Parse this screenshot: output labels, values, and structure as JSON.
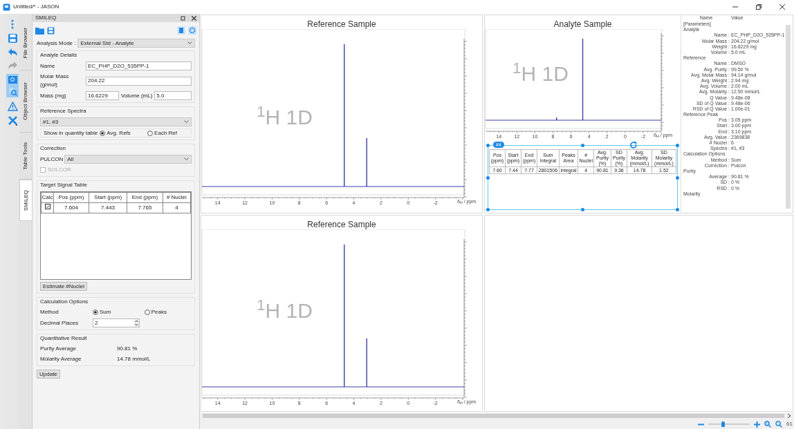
{
  "window": {
    "title": "Untitled/* - JASON"
  },
  "side_tabs": [
    {
      "label": "File Browser",
      "selected": false
    },
    {
      "label": "Object Browser",
      "selected": false
    },
    {
      "label": "Table Tools",
      "selected": false
    },
    {
      "label": "SMILEQ",
      "selected": true
    }
  ],
  "panel": {
    "title": "SMILEQ",
    "analysis_mode_label": "Analysis Mode :",
    "analysis_mode": "External Std - Analyte",
    "analyte_details": {
      "title": "Analyte Details",
      "fields": [
        {
          "label": "Name",
          "value": "EC_PHP_D2O_535PP-1"
        },
        {
          "label": "Molar Mass (g/mol)",
          "value": "204.22"
        }
      ],
      "mass_label": "Mass (mg)",
      "mass": "16.6229",
      "volume_label": "Volume (mL)",
      "volume": "5.0"
    },
    "reference_spectra": {
      "title": "Reference Spectra",
      "value": "#1, #3",
      "show_label": "Show in quantity table",
      "options": [
        {
          "label": "Avg. Refs",
          "selected": true
        },
        {
          "label": "Each Ref",
          "selected": false
        }
      ]
    },
    "correction": {
      "title": "Correction",
      "pulcon_label": "PULCON",
      "pulcon": "All",
      "solcor": {
        "label": "SOLCOR",
        "checked": false,
        "disabled": true
      }
    },
    "target_signal_table": {
      "title": "Target Signal Table",
      "calc_column": "Calc",
      "columns": [
        "Pos (ppm)",
        "Start (ppm)",
        "End (ppm)",
        "# Nuclei"
      ],
      "rows": [
        {
          "checked": true,
          "cells": [
            "7.604",
            "7.443",
            "7.765",
            "4"
          ]
        }
      ],
      "button": "Estimate #Nuclei"
    },
    "calculation_options": {
      "title": "Calculation Options",
      "method_label": "Method",
      "methods": [
        {
          "label": "Sum",
          "selected": true
        },
        {
          "label": "Peaks",
          "selected": false
        }
      ],
      "decimal_label": "Decimal Places",
      "decimal": "2"
    },
    "quantitative_result": {
      "title": "Quantitative Result",
      "rows": [
        {
          "label": "Purity Average",
          "value": "90.81 %"
        },
        {
          "label": "Molarity Average",
          "value": "14.78 mmol/L"
        }
      ]
    },
    "update_button": "Update"
  },
  "spectra": [
    {
      "title": "Reference Sample",
      "nucleus": "$^{1}$H 1D",
      "x_ticks": [
        "14",
        "12",
        "10",
        "8",
        "6",
        "4",
        "2",
        "0",
        "-2"
      ],
      "x_axis_label": "δ$_{H}$ / ppm"
    },
    {
      "title": "Analyte Sample",
      "nucleus": "$^{1}$H 1D",
      "x_ticks": [
        "14",
        "12",
        "10",
        "8",
        "6",
        "4",
        "2",
        "0",
        "-2"
      ],
      "x_axis_label": "δ$_{H}$ / ppm"
    },
    {
      "title": "Reference Sample",
      "nucleus": "$^{1}$H 1D",
      "x_ticks": [
        "14",
        "12",
        "10",
        "8",
        "6",
        "4",
        "2",
        "0",
        "-2"
      ],
      "x_axis_label": "δ$_{H}$ / ppm"
    }
  ],
  "result_table": {
    "badge": "#4",
    "columns": [
      "Pos (ppm)",
      "Start (ppm)",
      "End (ppm)",
      "Sum Integral",
      "Peaks Area",
      "# Nuclei",
      "Avg. Purity (%)",
      "SD Purity (%)",
      "Avg. Molarity (mmol/L)",
      "SD Molarity (mmol/L)"
    ],
    "rows": [
      [
        "7.60",
        "7.44",
        "7.77",
        "2801506",
        "integral",
        "4",
        "90.81",
        "9.36",
        "14.78",
        "1.52"
      ]
    ]
  },
  "parameters": {
    "columns": [
      "Name",
      "Value"
    ],
    "rows": [
      {
        "kind": "section",
        "label": "[Parameters]"
      },
      {
        "kind": "section",
        "label": "Analyte"
      },
      {
        "kind": "item",
        "name": "Name :",
        "value": "EC_PHP_D2O_535PP-1"
      },
      {
        "kind": "item",
        "name": "Molar Mass :",
        "value": "204.22 g/mol"
      },
      {
        "kind": "item",
        "name": "Weight :",
        "value": "16.6229 mg"
      },
      {
        "kind": "item",
        "name": "Volume :",
        "value": "5.0 mL"
      },
      {
        "kind": "section",
        "label": "Reference"
      },
      {
        "kind": "item",
        "name": "Name :",
        "value": "DMSO"
      },
      {
        "kind": "item",
        "name": "Avg. Purity :",
        "value": "99.50 %"
      },
      {
        "kind": "item",
        "name": "Avg. Molar Mass :",
        "value": "94.14 g/mol"
      },
      {
        "kind": "item",
        "name": "Avg. Weight :",
        "value": "2.94 mg"
      },
      {
        "kind": "item",
        "name": "Avg. Volume :",
        "value": "2.00 mL"
      },
      {
        "kind": "item",
        "name": "Avg. Molarity :",
        "value": "12.50 mmol/L"
      },
      {
        "kind": "item",
        "name": "Q Value :",
        "value": "9.48e-08"
      },
      {
        "kind": "item",
        "name": "SD of Q Value :",
        "value": "9.48e-06"
      },
      {
        "kind": "item",
        "name": "RSD of Q Value :",
        "value": "1.00e-01"
      },
      {
        "kind": "section",
        "label": "Reference Peak"
      },
      {
        "kind": "item",
        "name": "Pos :",
        "value": "3.05 ppm"
      },
      {
        "kind": "item",
        "name": "Start :",
        "value": "3.00 ppm"
      },
      {
        "kind": "item",
        "name": "End :",
        "value": "3.10 ppm"
      },
      {
        "kind": "item",
        "name": "Avg. Value :",
        "value": "2369838"
      },
      {
        "kind": "item",
        "name": "# Nuclei :",
        "value": "6"
      },
      {
        "kind": "item",
        "name": "Spectra :",
        "value": "#1, #3"
      },
      {
        "kind": "section",
        "label": "Calculation Options"
      },
      {
        "kind": "item",
        "name": "Method :",
        "value": "Sum"
      },
      {
        "kind": "item",
        "name": "Correction :",
        "value": "Pulcon"
      },
      {
        "kind": "section",
        "label": "Purity"
      },
      {
        "kind": "item",
        "name": "Average :",
        "value": "90.81 %"
      },
      {
        "kind": "item",
        "name": "SD :",
        "value": "0 %"
      },
      {
        "kind": "item",
        "name": "RSD :",
        "value": "0 %"
      },
      {
        "kind": "section",
        "label": "Molarity"
      }
    ]
  },
  "status_bar": {
    "zoom": "61",
    "zoom_slider": {
      "level": 0.35
    }
  }
}
